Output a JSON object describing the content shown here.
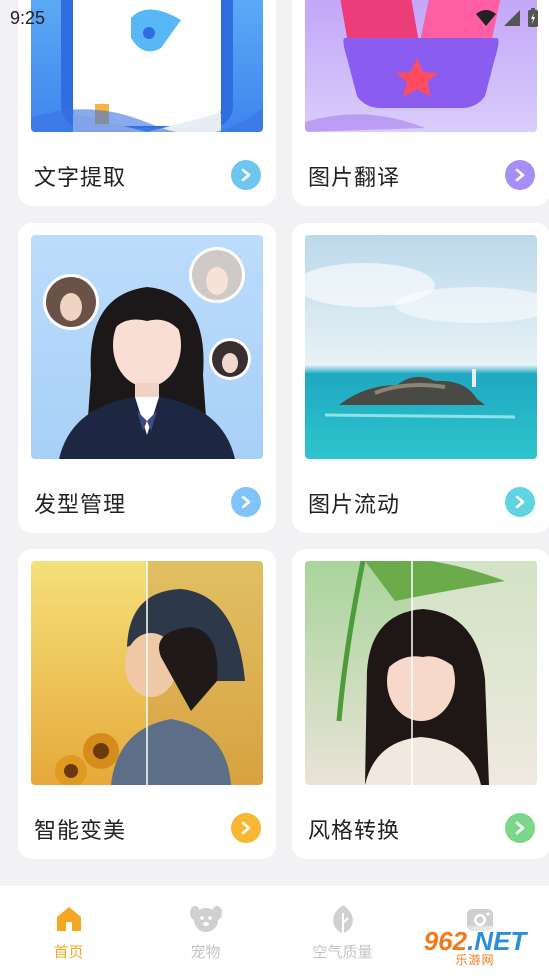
{
  "status": {
    "time": "9:25"
  },
  "cards": [
    {
      "label": "文字提取",
      "accent": "#6ec6f0",
      "bg": [
        "#5bb9f7",
        "#3d7de8"
      ]
    },
    {
      "label": "图片翻译",
      "accent": "#a58ef5",
      "bg": [
        "#b78df7",
        "#d6c7fb"
      ]
    },
    {
      "label": "发型管理",
      "accent": "#7fc3f8",
      "bg": [
        "#bfe1fb",
        "#9ac9f6"
      ]
    },
    {
      "label": "图片流动",
      "accent": "#62d3e0",
      "bg": [
        "#cfe6f3",
        "#2fc0c9"
      ]
    },
    {
      "label": "智能变美",
      "accent": "#f7b733",
      "bg": [
        "#f4d36a",
        "#e7a22c"
      ]
    },
    {
      "label": "风格转换",
      "accent": "#7bd88a",
      "bg": [
        "#b7dda8",
        "#ede7df"
      ]
    }
  ],
  "tabs": [
    {
      "label": "首页",
      "icon": "home-icon",
      "active": true
    },
    {
      "label": "宠物",
      "icon": "pet-icon",
      "active": false
    },
    {
      "label": "空气质量",
      "icon": "leaf-icon",
      "active": false
    },
    {
      "label": "",
      "icon": "camera-icon",
      "active": false
    }
  ],
  "watermark": {
    "number": "962",
    "suffix": ".NET",
    "subtitle": "乐游网"
  },
  "colors": {
    "active_tab": "#f5a623",
    "inactive_tab": "#c4c4c4",
    "background": "#f2f2f4"
  }
}
